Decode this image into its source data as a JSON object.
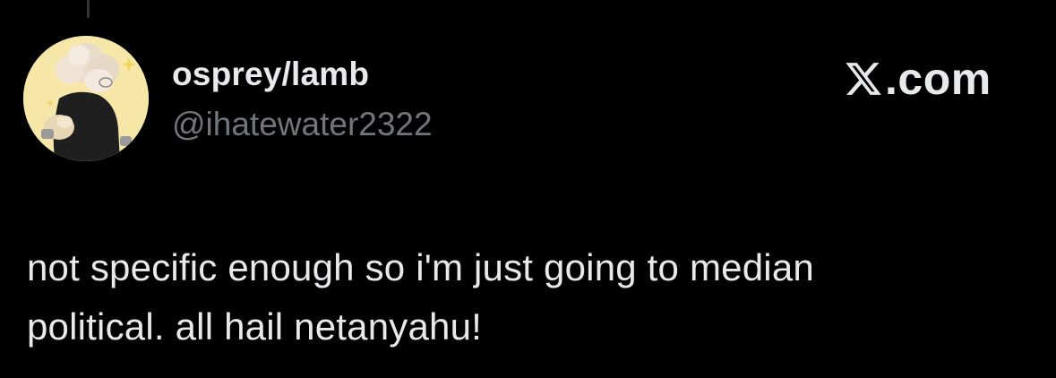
{
  "tweet": {
    "author": {
      "display_name": "osprey/lamb",
      "handle": "@ihatewater2322",
      "avatar_icon": "avatar-illustration"
    },
    "brand": {
      "logo_icon": "x-logo-icon",
      "domain": ".com"
    },
    "text_lines": [
      "not specific enough so i'm just going to median",
      "political. all hail netanyahu!"
    ]
  },
  "colors": {
    "background": "#000000",
    "primary_text": "#e7e9ea",
    "secondary_text": "#71767b",
    "thread_line": "#333639",
    "avatar_bg": "#f6e7a8"
  }
}
